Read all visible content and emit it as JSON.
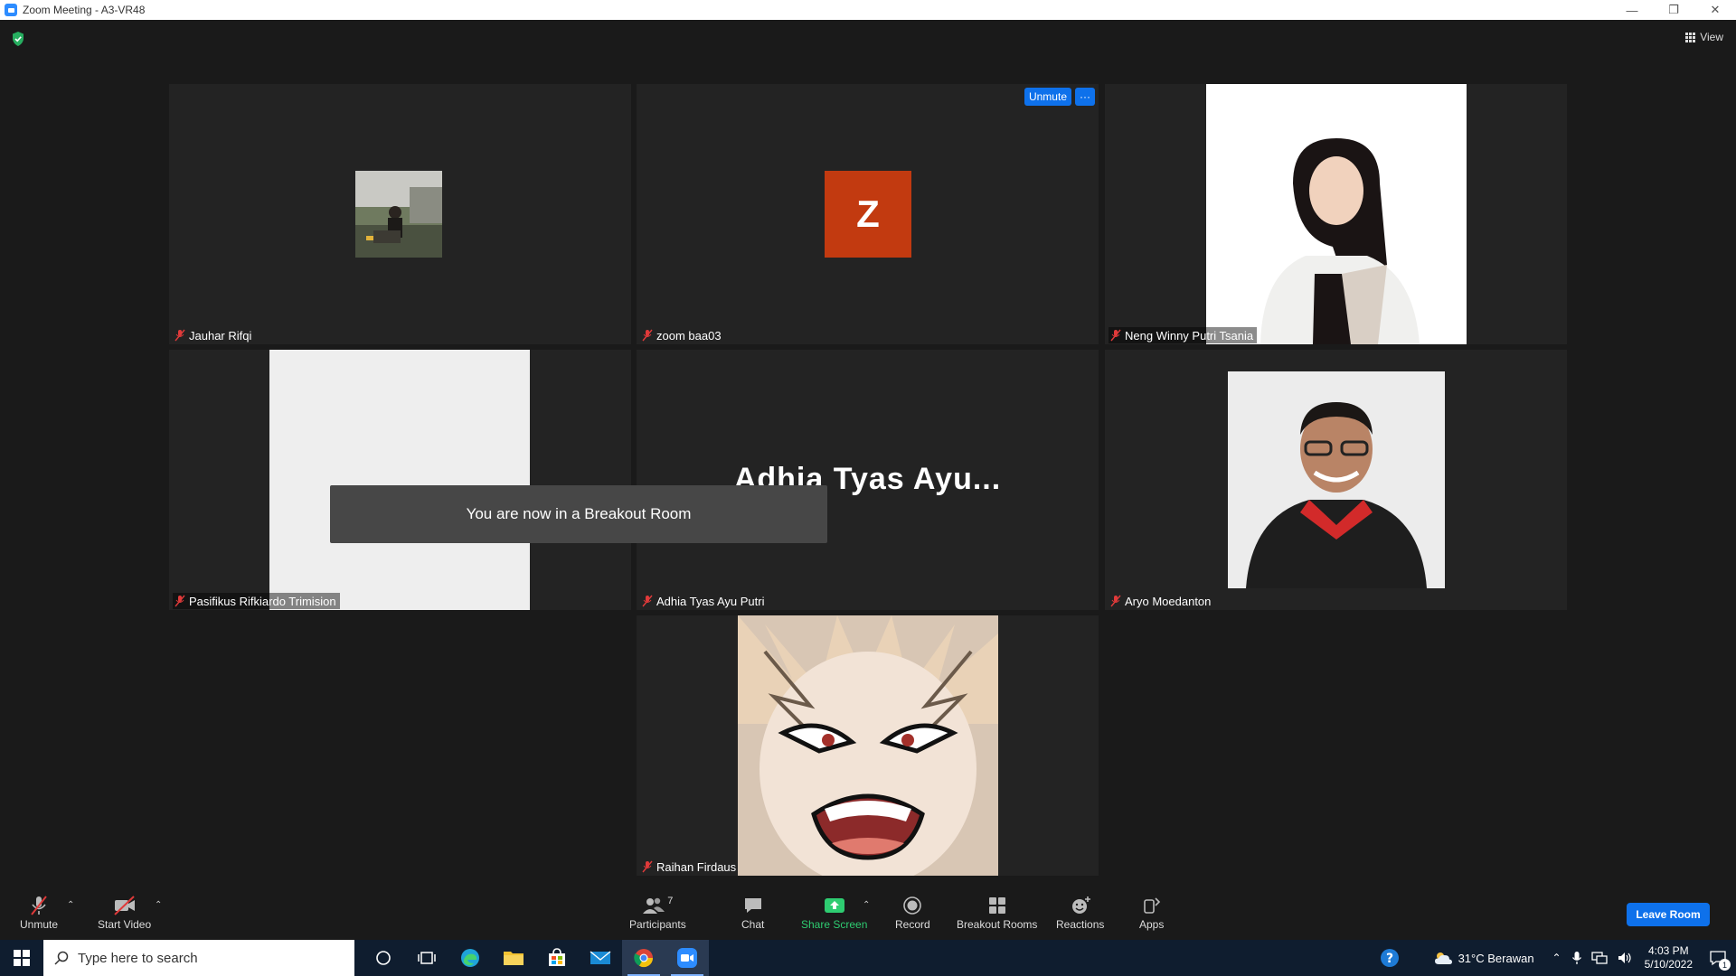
{
  "window": {
    "title": "Zoom Meeting - A3-VR48"
  },
  "header": {
    "view_label": "View"
  },
  "tiles": [
    {
      "name": "Jauhar Rifqi"
    },
    {
      "name": "zoom baa03",
      "initial": "Z",
      "unmute_label": "Unmute",
      "more_label": "···"
    },
    {
      "name": "Neng Winny Putri Tsania"
    },
    {
      "name": "Pasifikus Rifkiardo Trimision"
    },
    {
      "name": "Adhia Tyas Ayu Putri",
      "big_name": "Adhia Tyas Ayu..."
    },
    {
      "name": "Aryo Moedanton"
    },
    {
      "name": "Raihan Firdaus"
    }
  ],
  "toast": {
    "text": "You are now in a Breakout Room"
  },
  "toolbar": {
    "unmute": "Unmute",
    "start_video": "Start Video",
    "participants": "Participants",
    "participants_count": "7",
    "chat": "Chat",
    "share_screen": "Share Screen",
    "record": "Record",
    "breakout_rooms": "Breakout Rooms",
    "reactions": "Reactions",
    "apps": "Apps",
    "leave_room": "Leave Room"
  },
  "taskbar": {
    "search_placeholder": "Type here to search",
    "weather": "31°C  Berawan",
    "time": "4:03 PM",
    "date": "5/10/2022",
    "notification_count": "1"
  },
  "colors": {
    "accent": "#0e71eb",
    "share_green": "#2ecc71",
    "muted_red": "#e03a3a",
    "avatar_z": "#c23a10"
  }
}
